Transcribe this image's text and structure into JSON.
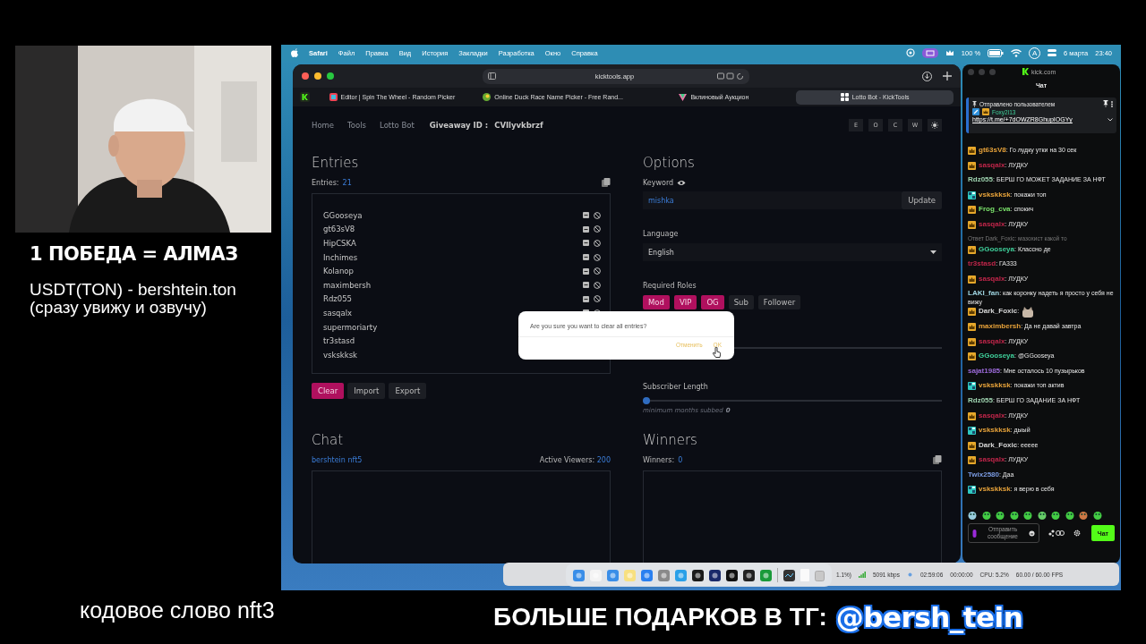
{
  "stream_overlay": {
    "headline": "1 ПОБЕДА = АЛМАЗ",
    "donation_line": "USDT(TON) - bershtein.ton",
    "donation_note": "(сразу увижу и озвучу)",
    "code_word": "кодовое слово nft3",
    "promo": "БОЛЬШЕ ПОДАРКОВ В ТГ:",
    "promo_handle": "@bersh_tein"
  },
  "menu_bar": {
    "app": "Safari",
    "items": [
      "Файл",
      "Правка",
      "Вид",
      "История",
      "Закладки",
      "Разработка",
      "Окно",
      "Справка"
    ],
    "battery": "100 %",
    "input_source": "A",
    "date": "6 марта",
    "time": "23:40"
  },
  "browser": {
    "address": "kicktools.app",
    "tabs": [
      {
        "title": "Editor | Spin The Wheel - Random Picker",
        "selected": false
      },
      {
        "title": "Online Duck Race Name Picker - Free Rand...",
        "selected": false
      },
      {
        "title": "Вклиновый Аукцион",
        "selected": false
      },
      {
        "title": "Lotto Bot - KickTools",
        "selected": true
      }
    ],
    "nav": {
      "links": [
        "Home",
        "Tools",
        "Lotto Bot"
      ],
      "giveaway_label": "Giveaway ID :",
      "giveaway_id": "CVIlyvkbrzf",
      "theme_buttons": [
        "E",
        "O",
        "C",
        "W"
      ]
    },
    "entries": {
      "title": "Entries",
      "count_label": "Entries:",
      "count": "21",
      "names": [
        "GGooseya",
        "gt63sV8",
        "HipCSKA",
        "Inchimes",
        "Kolanop",
        "maximbersh",
        "Rdz055",
        "sasqalx",
        "supermoriarty",
        "tr3stasd",
        "vskskksk"
      ],
      "buttons": [
        {
          "label": "Clear",
          "kind": "primary"
        },
        {
          "label": "Import",
          "kind": "plain"
        },
        {
          "label": "Export",
          "kind": "plain"
        }
      ]
    },
    "options": {
      "title": "Options",
      "keyword_label": "Keyword",
      "keyword": "mishka",
      "update_button": "Update",
      "language_label": "Language",
      "language": "English",
      "roles_label": "Required Roles",
      "roles": [
        {
          "label": "Mod",
          "selected": true
        },
        {
          "label": "VIP",
          "selected": true
        },
        {
          "label": "OG",
          "selected": true
        },
        {
          "label": "Sub",
          "selected": false
        },
        {
          "label": "Follower",
          "selected": false
        }
      ],
      "subscriber_label": "Subscriber Length",
      "subscriber_slider": {
        "level": 0
      },
      "subscriber_hint": "minimum months subbed",
      "subscriber_value": "0"
    },
    "chat": {
      "title": "Chat",
      "channel": "bershtein nft5",
      "viewers_label": "Active Viewers:",
      "viewers": "200"
    },
    "winners": {
      "title": "Winners",
      "count_label": "Winners:",
      "count": "0"
    },
    "dialog": {
      "message": "Are you sure you want to clear all entries?",
      "cancel": "Отменить",
      "ok": "OK"
    }
  },
  "kick_chat": {
    "site": "kick.com",
    "title": "Чат",
    "pinned": {
      "label": "Отправлено пользователем",
      "user": "Foxy2l13",
      "link": "https://t.me/+7dOWZR8GhupIOGYy"
    },
    "messages": [
      {
        "kind": "message",
        "crowned": true,
        "pixel_badge": false,
        "name": "gt63sV8",
        "color": "#e8a33a",
        "text": ": Го лудку утки на 30 сек"
      },
      {
        "kind": "message",
        "crowned": true,
        "pixel_badge": false,
        "name": "sasqalx",
        "color": "#c0264a",
        "text": ": ЛУДКУ"
      },
      {
        "kind": "message",
        "crowned": false,
        "pixel_badge": false,
        "name": "Rdz055",
        "color": "#9fd4b0",
        "text": ": БЕРШ ГО МОЖЕТ ЗАДАНИЕ ЗА НФТ"
      },
      {
        "kind": "message",
        "crowned": false,
        "pixel_badge": true,
        "name": "vskskksk",
        "color": "#e8a33a",
        "text": ": покажи топ"
      },
      {
        "kind": "message",
        "crowned": true,
        "pixel_badge": false,
        "name": "Frog_cva",
        "color": "#7be36b",
        "text": ": спокич"
      },
      {
        "kind": "message",
        "crowned": true,
        "pixel_badge": false,
        "name": "sasqalx",
        "color": "#c0264a",
        "text": ": ЛУДКУ"
      },
      {
        "kind": "reply",
        "text": "Ответ Dark_Foxic: мазохист какой то"
      },
      {
        "kind": "message",
        "crowned": true,
        "pixel_badge": false,
        "name": "GGooseya",
        "color": "#3fcf9a",
        "text": ": Классно де"
      },
      {
        "kind": "message",
        "crowned": false,
        "pixel_badge": false,
        "name": "tr3stasd",
        "color": "#c0264a",
        "text": ": ГА333"
      },
      {
        "kind": "message",
        "crowned": true,
        "pixel_badge": false,
        "name": "sasqalx",
        "color": "#c0264a",
        "text": ": ЛУДКУ"
      },
      {
        "kind": "message",
        "crowned": false,
        "pixel_badge": false,
        "name": "LAKI_fan",
        "color": "#9fd4e0",
        "text": ": как коронку надеть я просто у себя не вижу"
      },
      {
        "kind": "emote",
        "crowned": true,
        "pixel_badge": false,
        "name": "Dark_Foxic",
        "color": "#d8d8d8",
        "text": ":"
      },
      {
        "kind": "message",
        "crowned": true,
        "pixel_badge": false,
        "name": "maximbersh",
        "color": "#e8a33a",
        "text": ": Да не давай завтра"
      },
      {
        "kind": "message",
        "crowned": true,
        "pixel_badge": false,
        "name": "sasqalx",
        "color": "#c0264a",
        "text": ": ЛУДКУ"
      },
      {
        "kind": "message",
        "crowned": true,
        "pixel_badge": false,
        "name": "GGooseya",
        "color": "#3fcf9a",
        "text": ": @GGooseya"
      },
      {
        "kind": "message",
        "crowned": false,
        "pixel_badge": false,
        "name": "sajat1985",
        "color": "#9b6ad8",
        "text": ": Мне осталось 10 пузырьков"
      },
      {
        "kind": "message",
        "crowned": false,
        "pixel_badge": true,
        "name": "vskskksk",
        "color": "#e8a33a",
        "text": ": покажи топ актив"
      },
      {
        "kind": "message",
        "crowned": false,
        "pixel_badge": false,
        "name": "Rdz055",
        "color": "#9fd4b0",
        "text": ": БЕРШ ГО ЗАДАНИЕ ЗА НФТ"
      },
      {
        "kind": "message",
        "crowned": true,
        "pixel_badge": false,
        "name": "sasqalx",
        "color": "#c0264a",
        "text": ": ЛУДКУ"
      },
      {
        "kind": "message",
        "crowned": false,
        "pixel_badge": true,
        "name": "vskskksk",
        "color": "#e8a33a",
        "text": ": дыый"
      },
      {
        "kind": "message",
        "crowned": true,
        "pixel_badge": false,
        "name": "Dark_Foxic",
        "color": "#d8d8d8",
        "text": ": eeeee"
      },
      {
        "kind": "message",
        "crowned": true,
        "pixel_badge": false,
        "name": "sasqalx",
        "color": "#c0264a",
        "text": ": ЛУДКУ"
      },
      {
        "kind": "message",
        "crowned": false,
        "pixel_badge": false,
        "name": "Twix2580",
        "color": "#7a9ae0",
        "text": ": Даа"
      },
      {
        "kind": "message",
        "crowned": false,
        "pixel_badge": true,
        "name": "vskskksk",
        "color": "#e8a33a",
        "text": ": я верю в себя"
      }
    ],
    "input_placeholder": "Отправить сообщение",
    "send_button": "Чат"
  },
  "obs_status": [
    "1.1%)",
    "5091 kbps",
    "02:59:06",
    "00:00:00",
    "CPU: 5.2%",
    "60.00 / 60.00 FPS"
  ]
}
